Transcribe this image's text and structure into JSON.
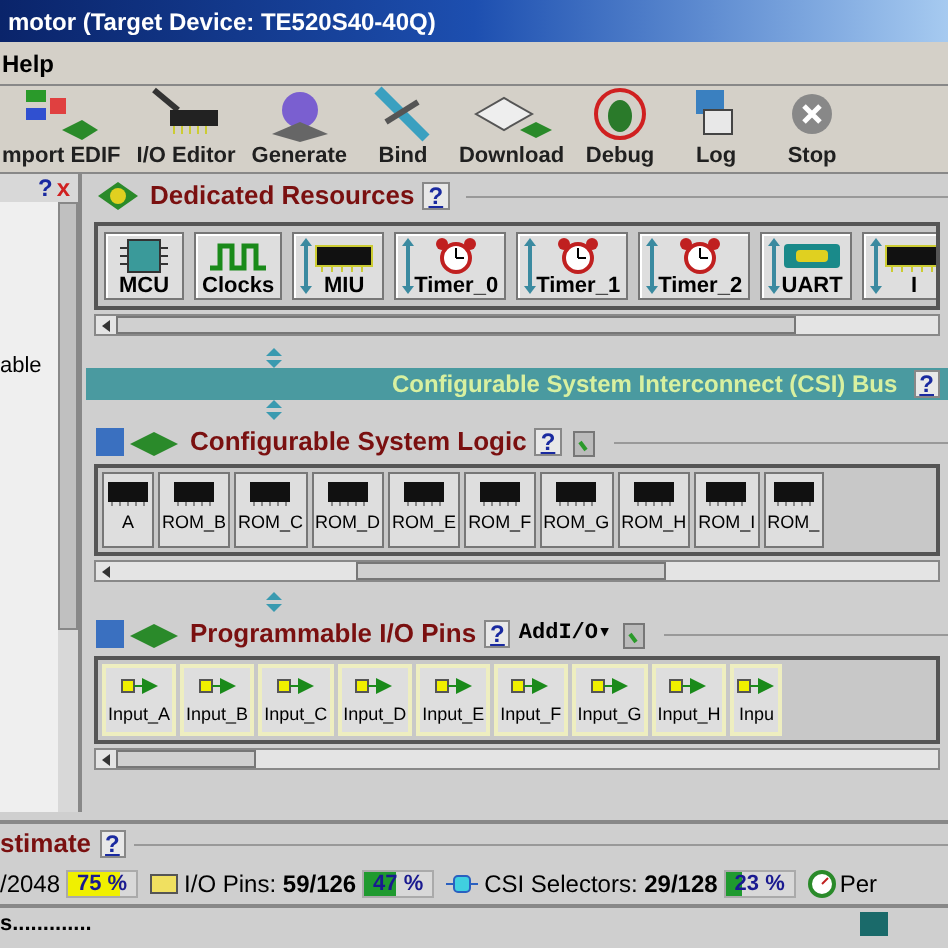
{
  "window": {
    "title": "motor (Target Device: TE520S40-40Q)"
  },
  "menu": [
    "Help"
  ],
  "toolbar": [
    {
      "label": "mport EDIF",
      "kind": "import"
    },
    {
      "label": "I/O Editor",
      "kind": "editor"
    },
    {
      "label": "Generate",
      "kind": "generate"
    },
    {
      "label": "Bind",
      "kind": "bind"
    },
    {
      "label": "Download",
      "kind": "download"
    },
    {
      "label": "Debug",
      "kind": "debug"
    },
    {
      "label": "Log",
      "kind": "log"
    },
    {
      "label": "Stop",
      "kind": "stop"
    }
  ],
  "side_panel": {
    "help": "?",
    "close": "x",
    "text": "able"
  },
  "dedicated": {
    "title": "Dedicated Resources",
    "help": "?",
    "items": [
      {
        "label": "MCU",
        "kind": "chip",
        "linked": false
      },
      {
        "label": "Clocks",
        "kind": "wave",
        "linked": false
      },
      {
        "label": "MIU",
        "kind": "memory",
        "linked": true
      },
      {
        "label": "Timer_0",
        "kind": "timer",
        "linked": true
      },
      {
        "label": "Timer_1",
        "kind": "timer",
        "linked": true
      },
      {
        "label": "Timer_2",
        "kind": "timer",
        "linked": true
      },
      {
        "label": "UART",
        "kind": "port",
        "linked": true
      },
      {
        "label": "I",
        "kind": "memory",
        "linked": true
      }
    ]
  },
  "bus": {
    "title": "Configurable System Interconnect (CSI) Bus",
    "help": "?"
  },
  "logic": {
    "title": "Configurable System Logic",
    "help": "?",
    "items": [
      "A",
      "ROM_B",
      "ROM_C",
      "ROM_D",
      "ROM_E",
      "ROM_F",
      "ROM_G",
      "ROM_H",
      "ROM_I",
      "ROM_"
    ]
  },
  "io": {
    "title": "Programmable I/O Pins",
    "help": "?",
    "add": "AddI/O",
    "add_caret": "▾",
    "items": [
      "Input_A",
      "Input_B",
      "Input_C",
      "Input_D",
      "Input_E",
      "Input_F",
      "Input_G",
      "Input_H",
      "Inpu"
    ]
  },
  "estimate": {
    "title": "stimate",
    "help": "?",
    "stats": [
      {
        "label": "/2048",
        "reading": "75 %",
        "level": 0.75,
        "color": "#f0f000",
        "kind": "plain"
      },
      {
        "label": "I/O Pins: **59/126**",
        "reading": "47 %",
        "level": 0.47,
        "color": "#1f9a2f",
        "kind": "pins"
      },
      {
        "label": "CSI Selectors: **29/128**",
        "reading": "23 %",
        "level": 0.23,
        "color": "#1f9a2f",
        "kind": "csi"
      }
    ],
    "tail": "Per"
  },
  "status_bar": "s............."
}
